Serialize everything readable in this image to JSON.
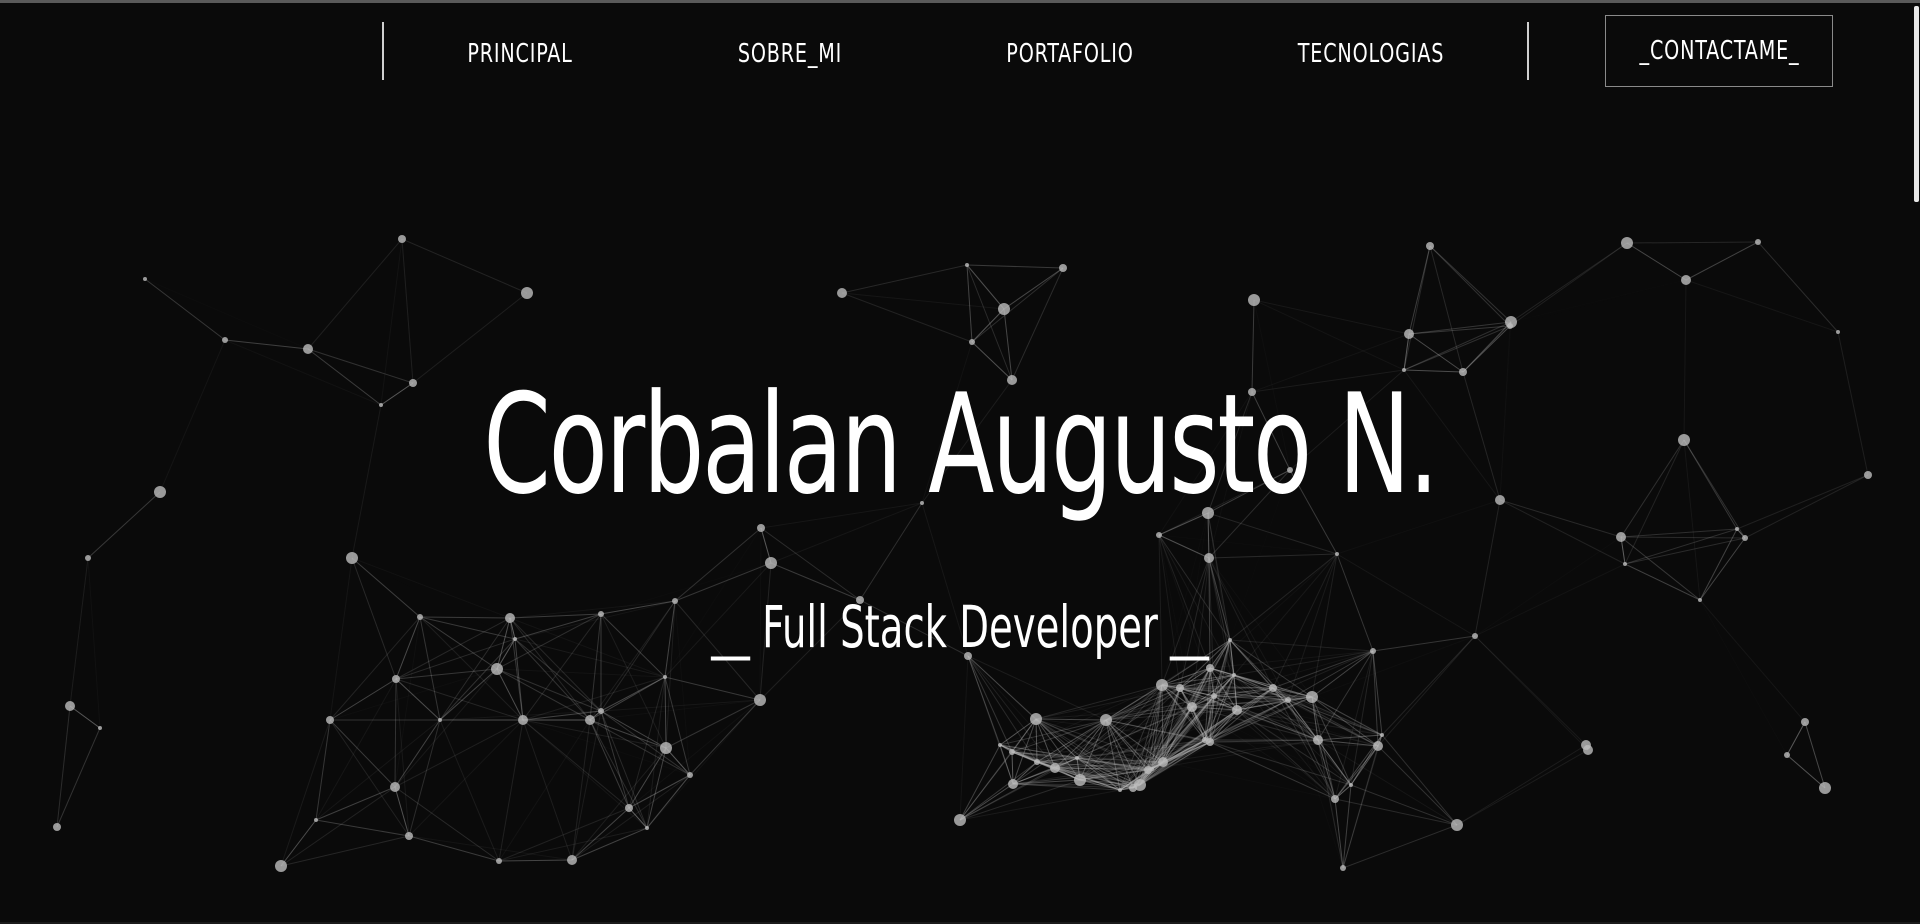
{
  "nav": {
    "links": [
      {
        "label": "PRINCIPAL"
      },
      {
        "label": "SOBRE_MI"
      },
      {
        "label": "PORTAFOLIO"
      },
      {
        "label": "TECNOLOGIAS"
      }
    ],
    "contact_label": "_CONTACTAME_"
  },
  "hero": {
    "title": "Corbalan Augusto N.",
    "subtitle": "__ Full Stack Developer __"
  },
  "colors": {
    "background": "#0a0a0a",
    "text": "#ffffff",
    "network": "#bdbdbd"
  }
}
